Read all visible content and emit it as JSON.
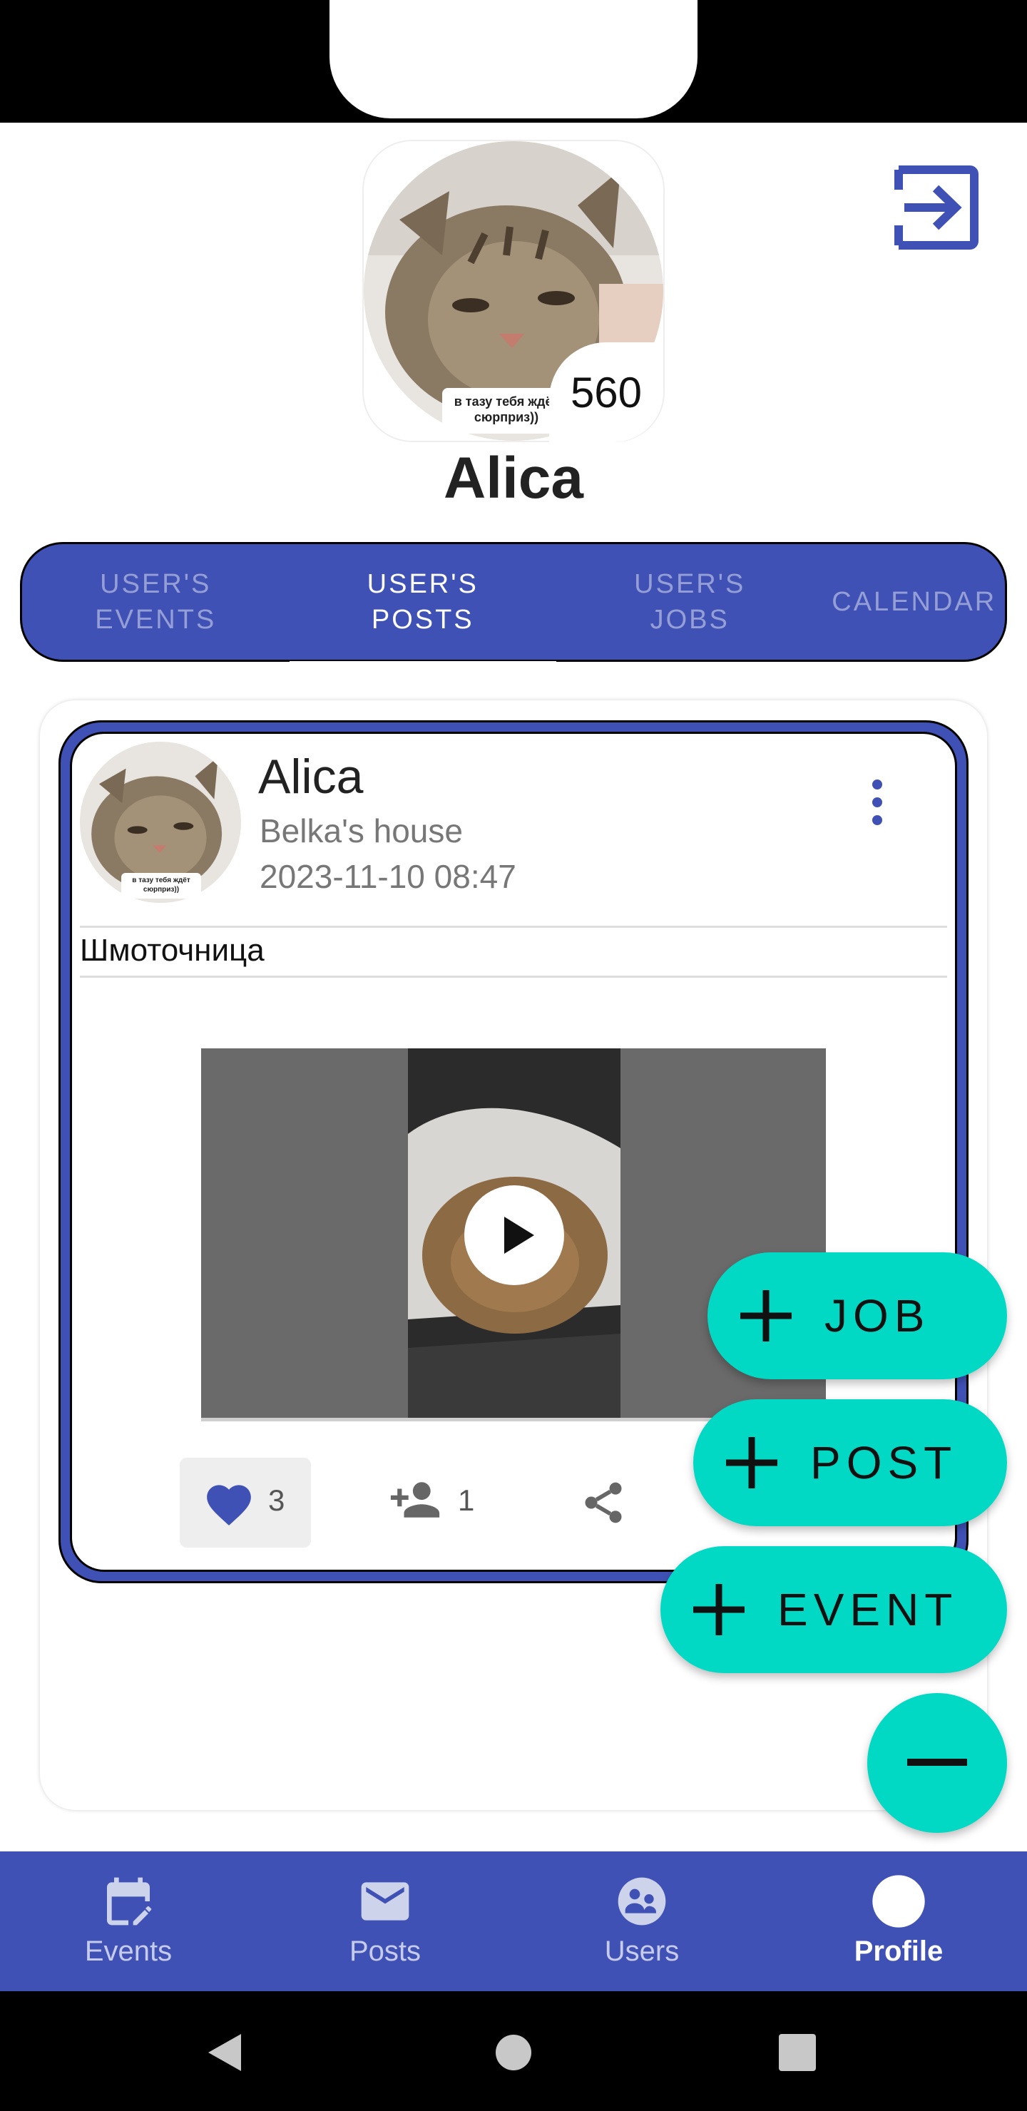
{
  "profile": {
    "name": "Alica",
    "score": "560",
    "avatar_caption": "в тазу тебя ждёт сюрприз))"
  },
  "tabs": [
    {
      "label": "USER'S EVENTS",
      "active": false
    },
    {
      "label": "USER'S POSTS",
      "active": true
    },
    {
      "label": "USER'S JOBS",
      "active": false
    },
    {
      "label": "CALENDAR",
      "active": false
    }
  ],
  "post": {
    "author": "Alica",
    "location": "Belka's house",
    "date": "2023-11-10 08:47",
    "text": "Шмоточница",
    "avatar_caption": "в тазу тебя ждёт сюрприз))",
    "likes": "3",
    "participants": "1"
  },
  "fabs": {
    "job": "JOB",
    "post": "POST",
    "event": "EVENT"
  },
  "nav": [
    {
      "label": "Events",
      "icon": "calendar-edit-icon",
      "active": false
    },
    {
      "label": "Posts",
      "icon": "mail-icon",
      "active": false
    },
    {
      "label": "Users",
      "icon": "users-icon",
      "active": false
    },
    {
      "label": "Profile",
      "icon": "profile-avatar-icon",
      "active": true
    }
  ],
  "colors": {
    "primary": "#3f51b5",
    "accent": "#02d9c4"
  },
  "icons": {
    "logout": "logout-icon",
    "menu": "more-vert-icon",
    "like": "heart-icon",
    "participants": "person-add-icon",
    "share": "share-icon",
    "play": "play-icon",
    "collapse": "minus-icon"
  }
}
